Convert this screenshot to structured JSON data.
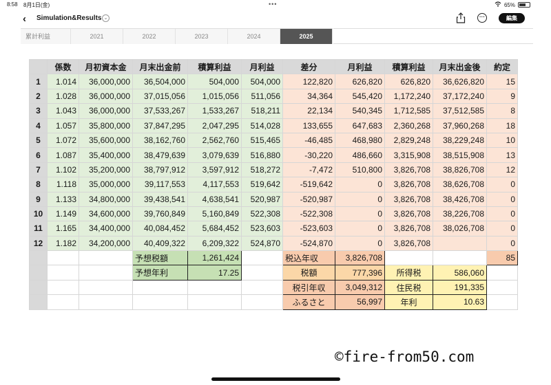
{
  "status_bar": {
    "time": "8:58",
    "date": "8月1日(金)",
    "dots": "•••",
    "battery_pct": "65%",
    "battery_level": 0.65
  },
  "nav": {
    "back": "‹",
    "title": "Simulation&Results",
    "title_chevron": "⌄",
    "more": "···",
    "edit": "編集"
  },
  "tabs": [
    "累計利益",
    "2021",
    "2022",
    "2023",
    "2024",
    "2025"
  ],
  "active_tab": "2025",
  "headers": [
    "係数",
    "月初資本金",
    "月末出金前",
    "積算利益",
    "月利益",
    "差分",
    "月利益",
    "積算利益",
    "月末出金後",
    "約定"
  ],
  "rows": [
    {
      "n": "1",
      "k": "1.014",
      "cap": "36,000,000",
      "pre": "36,504,000",
      "cum": "504,000",
      "mon": "504,000",
      "diff": "122,820",
      "mon2": "626,820",
      "cum2": "626,820",
      "post": "36,626,820",
      "trades": "15"
    },
    {
      "n": "2",
      "k": "1.028",
      "cap": "36,000,000",
      "pre": "37,015,056",
      "cum": "1,015,056",
      "mon": "511,056",
      "diff": "34,364",
      "mon2": "545,420",
      "cum2": "1,172,240",
      "post": "37,172,240",
      "trades": "9"
    },
    {
      "n": "3",
      "k": "1.043",
      "cap": "36,000,000",
      "pre": "37,533,267",
      "cum": "1,533,267",
      "mon": "518,211",
      "diff": "22,134",
      "mon2": "540,345",
      "cum2": "1,712,585",
      "post": "37,512,585",
      "trades": "8"
    },
    {
      "n": "4",
      "k": "1.057",
      "cap": "35,800,000",
      "pre": "37,847,295",
      "cum": "2,047,295",
      "mon": "514,028",
      "diff": "133,655",
      "mon2": "647,683",
      "cum2": "2,360,268",
      "post": "37,960,268",
      "trades": "18"
    },
    {
      "n": "5",
      "k": "1.072",
      "cap": "35,600,000",
      "pre": "38,162,760",
      "cum": "2,562,760",
      "mon": "515,465",
      "diff": "-46,485",
      "mon2": "468,980",
      "cum2": "2,829,248",
      "post": "38,229,248",
      "trades": "10"
    },
    {
      "n": "6",
      "k": "1.087",
      "cap": "35,400,000",
      "pre": "38,479,639",
      "cum": "3,079,639",
      "mon": "516,880",
      "diff": "-30,220",
      "mon2": "486,660",
      "cum2": "3,315,908",
      "post": "38,515,908",
      "trades": "13"
    },
    {
      "n": "7",
      "k": "1.102",
      "cap": "35,200,000",
      "pre": "38,797,912",
      "cum": "3,597,912",
      "mon": "518,272",
      "diff": "-7,472",
      "mon2": "510,800",
      "cum2": "3,826,708",
      "post": "38,826,708",
      "trades": "12"
    },
    {
      "n": "8",
      "k": "1.118",
      "cap": "35,000,000",
      "pre": "39,117,553",
      "cum": "4,117,553",
      "mon": "519,642",
      "diff": "-519,642",
      "mon2": "0",
      "cum2": "3,826,708",
      "post": "38,626,708",
      "trades": "0"
    },
    {
      "n": "9",
      "k": "1.133",
      "cap": "34,800,000",
      "pre": "39,438,541",
      "cum": "4,638,541",
      "mon": "520,987",
      "diff": "-520,987",
      "mon2": "0",
      "cum2": "3,826,708",
      "post": "38,426,708",
      "trades": "0"
    },
    {
      "n": "10",
      "k": "1.149",
      "cap": "34,600,000",
      "pre": "39,760,849",
      "cum": "5,160,849",
      "mon": "522,308",
      "diff": "-522,308",
      "mon2": "0",
      "cum2": "3,826,708",
      "post": "38,226,708",
      "trades": "0"
    },
    {
      "n": "11",
      "k": "1.165",
      "cap": "34,400,000",
      "pre": "40,084,452",
      "cum": "5,684,452",
      "mon": "523,603",
      "diff": "-523,603",
      "mon2": "0",
      "cum2": "3,826,708",
      "post": "38,026,708",
      "trades": "0"
    },
    {
      "n": "12",
      "k": "1.182",
      "cap": "34,200,000",
      "pre": "40,409,322",
      "cum": "6,209,322",
      "mon": "524,870",
      "diff": "-524,870",
      "mon2": "0",
      "cum2": "3,826,708",
      "post": "",
      "trades": "0"
    }
  ],
  "summary": {
    "tax_estimate_label": "予想税額",
    "tax_estimate_value": "1,261,424",
    "annual_yield_label": "予想年利",
    "annual_yield_value": "17.25",
    "pretax_label": "税込年収",
    "pretax_value": "3,826,708",
    "trades_total": "85",
    "tax_label": "税額",
    "tax_value": "777,396",
    "income_tax_label": "所得税",
    "income_tax_value": "586,060",
    "aftertax_label": "税引年収",
    "aftertax_value": "3,049,312",
    "resident_tax_label": "住民税",
    "resident_tax_value": "191,335",
    "furusato_label": "ふるさと",
    "furusato_value": "56,997",
    "yearly_label": "年利",
    "yearly_value": "10.63"
  },
  "copyright": "©fire-from50.com",
  "colors": {
    "green": "#e2efda",
    "pink": "#fce4d6",
    "header": "#d9d9d9",
    "active_tab": "#555555"
  }
}
